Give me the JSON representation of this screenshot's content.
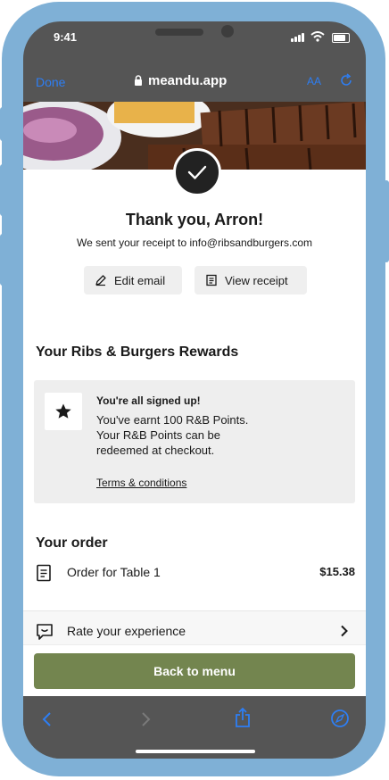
{
  "status_bar": {
    "time": "9:41"
  },
  "browser": {
    "done_label": "Done",
    "url": "meandu.app",
    "text_size_label": "AA"
  },
  "confirmation": {
    "title": "Thank you, Arron!",
    "receipt_text": "We sent your receipt to info@ribsandburgers.com",
    "edit_email_label": "Edit email",
    "view_receipt_label": "View receipt"
  },
  "rewards": {
    "section_title": "Your Ribs & Burgers Rewards",
    "heading": "You're all signed up!",
    "line1": "You've earnt 100 R&B Points.",
    "line2": "Your R&B Points can be",
    "line3": "redeemed at checkout.",
    "terms_label": "Terms & conditions"
  },
  "order": {
    "section_title": "Your order",
    "row_label": "Order for Table 1",
    "row_amount": "$15.38",
    "rate_label": "Rate your experience"
  },
  "cta": {
    "back_label": "Back to menu"
  },
  "colors": {
    "frame": "#7fb0d6",
    "link_blue": "#2d7ef4",
    "cta_green": "#73854f"
  },
  "icons": [
    "lock-icon",
    "text-size-icon",
    "reload-icon",
    "checkmark-icon",
    "pencil-icon",
    "receipt-icon",
    "star-icon",
    "document-icon",
    "chat-smile-icon",
    "chevron-right-icon",
    "back-icon",
    "forward-icon",
    "share-icon",
    "compass-icon"
  ]
}
